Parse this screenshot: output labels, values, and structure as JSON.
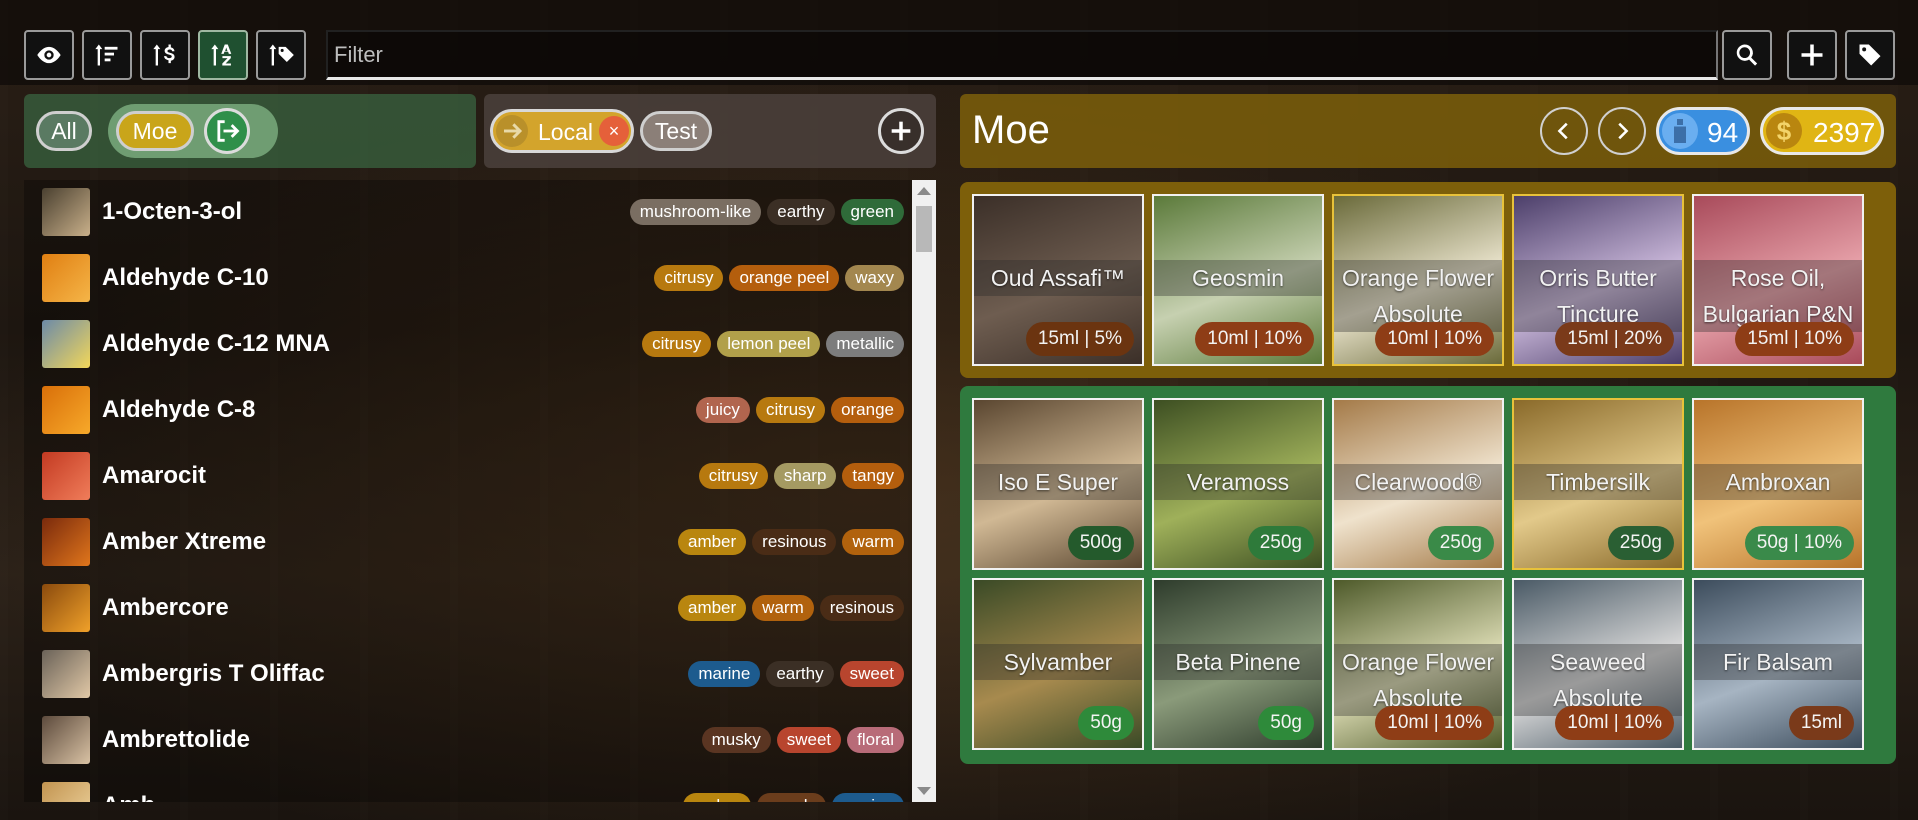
{
  "toolbar": {
    "filter_placeholder": "Filter",
    "left_buttons": [
      {
        "icon": "eye-icon"
      },
      {
        "icon": "sort-lines-icon"
      },
      {
        "icon": "sort-price-icon"
      },
      {
        "icon": "sort-alpha-icon",
        "active": true
      },
      {
        "icon": "sort-tag-icon"
      }
    ],
    "right_buttons": [
      {
        "icon": "search-icon"
      },
      {
        "icon": "plus-icon"
      },
      {
        "icon": "tag-icon"
      }
    ]
  },
  "profiles": {
    "all_label": "All",
    "current_label": "Moe",
    "colors": {
      "panel": "#3c6e46",
      "current_pill": "#c9a51a"
    }
  },
  "inventories": {
    "local_label": "Local",
    "local_close": "×",
    "test_label": "Test"
  },
  "materials": [
    {
      "name": "1-Octen-3-ol",
      "thumb": [
        "#4a4030",
        "#c9b08a"
      ],
      "tags": [
        [
          "mushroom-like",
          "#7a6e62"
        ],
        [
          "earthy",
          "#3b2f25"
        ],
        [
          "green",
          "#2f6b39"
        ]
      ]
    },
    {
      "name": "Aldehyde C-10",
      "thumb": [
        "#e07f12",
        "#f5b548"
      ],
      "tags": [
        [
          "citrusy",
          "#b7790f"
        ],
        [
          "orange peel",
          "#b45e0d"
        ],
        [
          "waxy",
          "#a3874f"
        ]
      ]
    },
    {
      "name": "Aldehyde C-12 MNA",
      "thumb": [
        "#6c8aa8",
        "#f2d75a"
      ],
      "tags": [
        [
          "citrusy",
          "#b7790f"
        ],
        [
          "lemon peel",
          "#b1a04a"
        ],
        [
          "metallic",
          "#7d7d7d"
        ]
      ]
    },
    {
      "name": "Aldehyde C-8",
      "thumb": [
        "#d96f09",
        "#f7a92a"
      ],
      "tags": [
        [
          "juicy",
          "#b1654e"
        ],
        [
          "citrusy",
          "#b7790f"
        ],
        [
          "orange",
          "#b45e0d"
        ]
      ]
    },
    {
      "name": "Amarocit",
      "thumb": [
        "#c33a22",
        "#f07d5a"
      ],
      "tags": [
        [
          "citrusy",
          "#b7790f"
        ],
        [
          "sharp",
          "#a59a62"
        ],
        [
          "tangy",
          "#b45e0d"
        ]
      ]
    },
    {
      "name": "Amber Xtreme",
      "thumb": [
        "#7a2a0c",
        "#e0761c"
      ],
      "tags": [
        [
          "amber",
          "#b9860f"
        ],
        [
          "resinous",
          "#4a2c16"
        ],
        [
          "warm",
          "#b1620d"
        ]
      ]
    },
    {
      "name": "Ambercore",
      "thumb": [
        "#8a4a0d",
        "#f0a12a"
      ],
      "tags": [
        [
          "amber",
          "#b9860f"
        ],
        [
          "warm",
          "#b1620d"
        ],
        [
          "resinous",
          "#4a2c16"
        ]
      ]
    },
    {
      "name": "Ambergris T Oliffac",
      "thumb": [
        "#6a6258",
        "#e1c8a6"
      ],
      "tags": [
        [
          "marine",
          "#1d5b8e"
        ],
        [
          "earthy",
          "#3b2f25"
        ],
        [
          "sweet",
          "#b8452e"
        ]
      ]
    },
    {
      "name": "Ambrettolide",
      "thumb": [
        "#5c4a3c",
        "#d9c2a4"
      ],
      "tags": [
        [
          "musky",
          "#5a3522"
        ],
        [
          "sweet",
          "#b8452e"
        ],
        [
          "floral",
          "#b86b78"
        ]
      ]
    },
    {
      "name": "Amb...",
      "thumb": [
        "#c29450",
        "#f0d6a2"
      ],
      "tags": [
        [
          "amber",
          "#b9860f"
        ],
        [
          "woody",
          "#6b3d1c"
        ],
        [
          "marine",
          "#1d5b8e"
        ]
      ]
    }
  ],
  "panel": {
    "title": "Moe",
    "prev_icon": "chevron-left-icon",
    "next_icon": "chevron-right-icon",
    "bottles_count": "94",
    "coins_count": "2397",
    "colors": {
      "header": "#7d5f0a",
      "bottles": "#3a8fe0",
      "coins": "#e0b514",
      "wishlist_group": "#7d5f0a",
      "owned_group": "#2f7a3e"
    }
  },
  "wishlist": [
    {
      "name": "Oud Assafi™",
      "badge": "15ml | 5%",
      "bg": [
        "#3b2f28",
        "#6e5d50"
      ],
      "badge_color": "#6b3410",
      "gold": false
    },
    {
      "name": "Geosmin",
      "badge": "10ml | 10%",
      "bg": [
        "#5b7a3a",
        "#c6d0b0"
      ],
      "badge_color": "#8e3d16",
      "gold": false
    },
    {
      "name": "Orange Flower Absolute",
      "badge": "10ml | 10%",
      "bg": [
        "#6a6a3a",
        "#e6e0c8"
      ],
      "badge_color": "#8e3d16",
      "gold": true
    },
    {
      "name": "Orris Butter Tincture",
      "badge": "15ml | 20%",
      "bg": [
        "#4c3f6a",
        "#c8b6d8"
      ],
      "badge_color": "#7a3a1a",
      "gold": true
    },
    {
      "name": "Rose Oil, Bulgarian P&N",
      "badge": "15ml | 10%",
      "bg": [
        "#a84a5a",
        "#e6a0a8"
      ],
      "badge_color": "#8e3d16",
      "gold": false
    }
  ],
  "owned": [
    {
      "name": "Iso E Super",
      "badge": "500g",
      "bg": [
        "#5a4630",
        "#d0b894"
      ],
      "badge_color": "#245a2c",
      "gold": false
    },
    {
      "name": "Veramoss",
      "badge": "250g",
      "bg": [
        "#3d4f22",
        "#9fb05a"
      ],
      "badge_color": "#2e7a3a",
      "gold": false
    },
    {
      "name": "Clearwood®",
      "badge": "250g",
      "bg": [
        "#a47a48",
        "#efe2cc"
      ],
      "badge_color": "#3a8a48",
      "gold": false
    },
    {
      "name": "Timbersilk",
      "badge": "250g",
      "bg": [
        "#8a6a2a",
        "#e2c98a"
      ],
      "badge_color": "#2a5f33",
      "gold": true
    },
    {
      "name": "Ambroxan",
      "badge": "50g | 10%",
      "bg": [
        "#b8742a",
        "#f0c27a"
      ],
      "badge_color": "#3a8a4a",
      "gold": false
    },
    {
      "name": "Sylvamber",
      "badge": "50g",
      "bg": [
        "#3a4a26",
        "#a78a4e"
      ],
      "badge_color": "#2e8a3a",
      "gold": false
    },
    {
      "name": "Beta Pinene",
      "badge": "50g",
      "bg": [
        "#2e3c2c",
        "#8a9a7a"
      ],
      "badge_color": "#2e8a3a",
      "gold": false
    },
    {
      "name": "Orange Flower Absolute",
      "badge": "10ml | 10%",
      "bg": [
        "#4e5a2a",
        "#d8d8b0"
      ],
      "badge_color": "#8e3d16",
      "gold": false
    },
    {
      "name": "Seaweed Absolute",
      "badge": "10ml | 10%",
      "bg": [
        "#4a5a66",
        "#d8d8d8"
      ],
      "badge_color": "#8e3d16",
      "gold": false
    },
    {
      "name": "Fir Balsam",
      "badge": "15ml",
      "bg": [
        "#3c4c5c",
        "#a6b4c2"
      ],
      "badge_color": "#7a3a1a",
      "gold": false
    }
  ]
}
